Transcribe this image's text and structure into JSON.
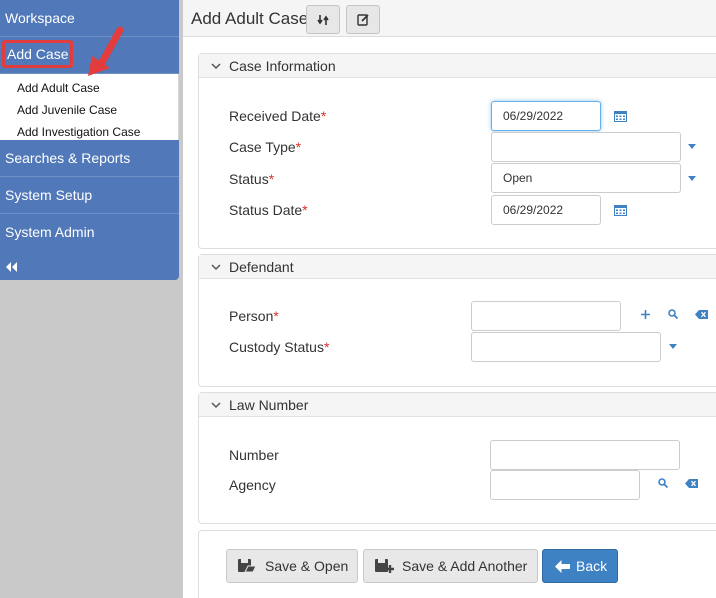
{
  "sidebar": {
    "items": [
      {
        "label": "Workspace"
      },
      {
        "label": "Add Case"
      },
      {
        "label": "Searches & Reports"
      },
      {
        "label": "System Setup"
      },
      {
        "label": "System Admin"
      }
    ],
    "submenu": [
      "Add Adult Case",
      "Add Juvenile Case",
      "Add Investigation Case"
    ],
    "collapse_icon": "double-chevron-left-icon"
  },
  "header": {
    "title": "Add Adult Case",
    "buttons": [
      "swap-icon",
      "edit-icon"
    ]
  },
  "case_info": {
    "title": "Case Information",
    "received_date_label": "Received Date",
    "received_date_value": "06/29/2022",
    "case_type_label": "Case Type",
    "case_type_value": "",
    "status_label": "Status",
    "status_value": "Open",
    "status_date_label": "Status Date",
    "status_date_value": "06/29/2022",
    "required_mark": "*"
  },
  "defendant": {
    "title": "Defendant",
    "person_label": "Person",
    "person_value": "",
    "custody_label": "Custody Status",
    "custody_value": ""
  },
  "law_number": {
    "title": "Law Number",
    "number_label": "Number",
    "number_value": "",
    "agency_label": "Agency",
    "agency_value": ""
  },
  "actions": {
    "save_open": "Save & Open",
    "save_another": "Save & Add Another",
    "back": "Back"
  },
  "colors": {
    "sidebar": "#5178b8",
    "required": "#d9312a",
    "primary": "#3f82c4",
    "highlight": "#e23c3c",
    "icon": "#3f82c4"
  }
}
